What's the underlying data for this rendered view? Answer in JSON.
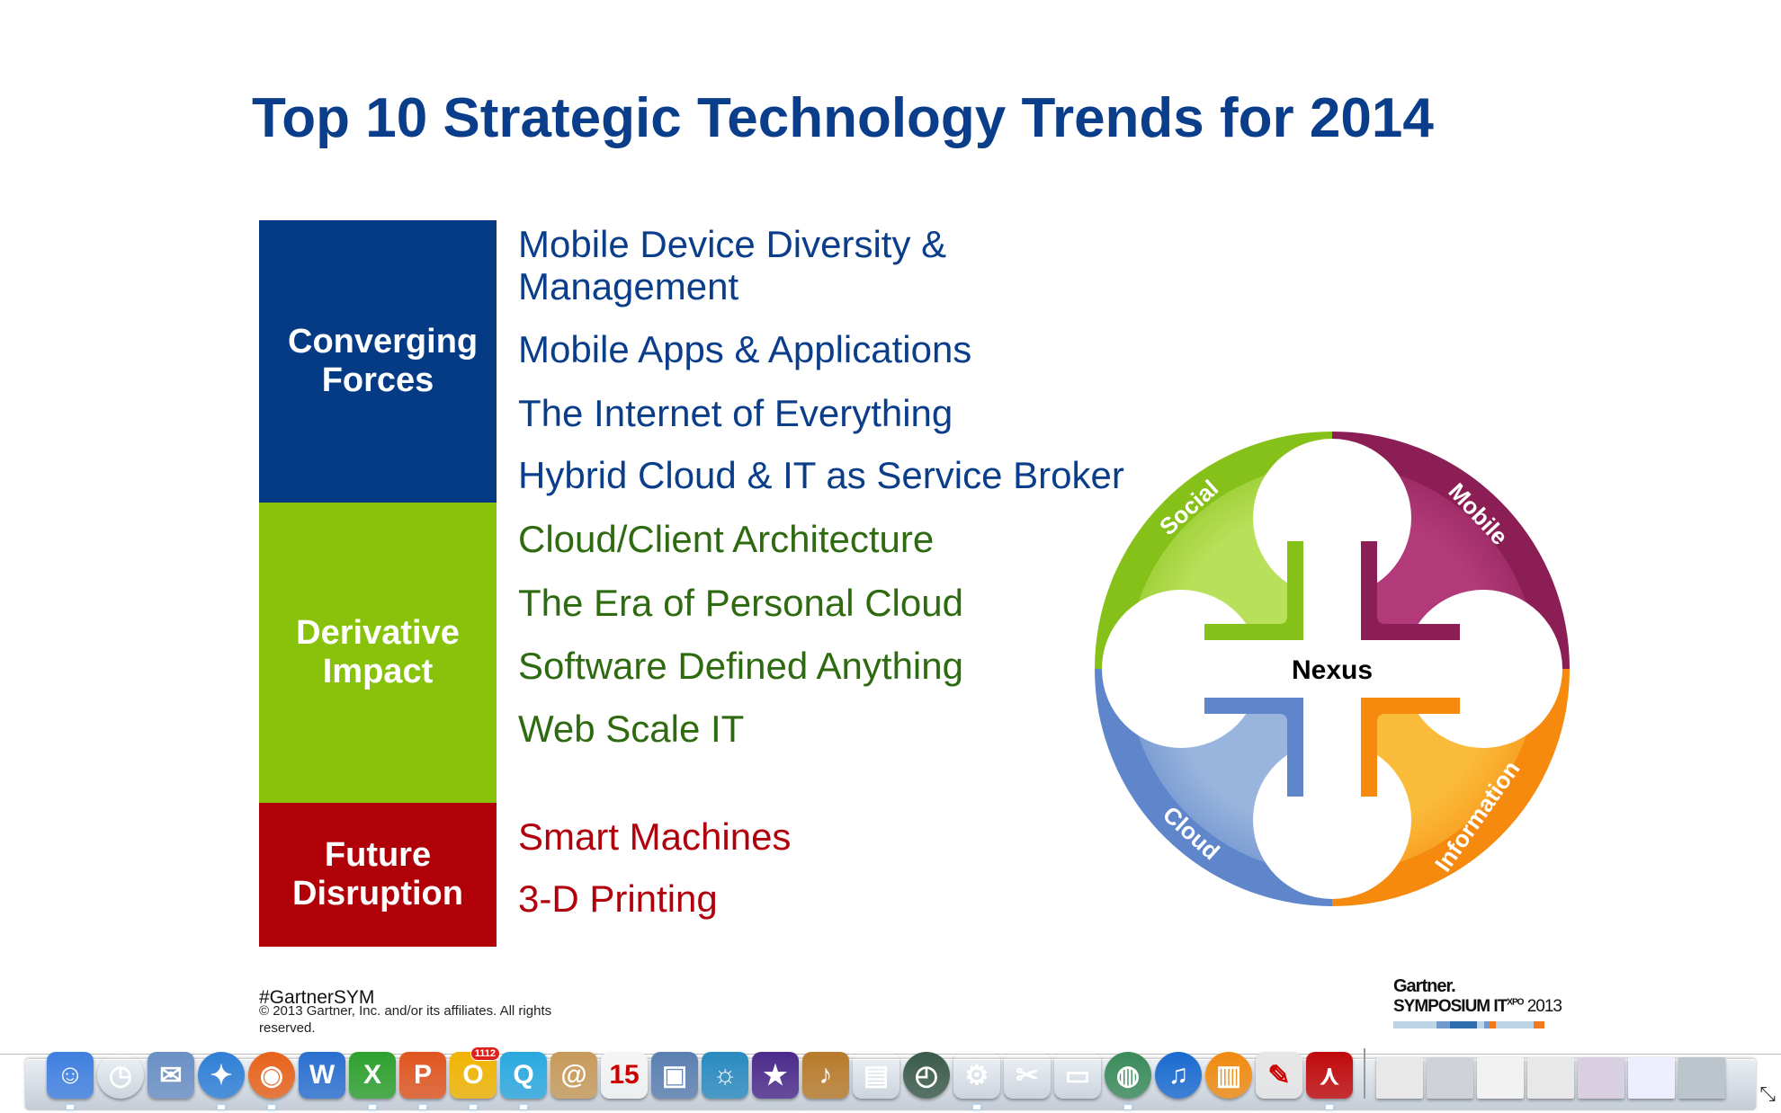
{
  "slide": {
    "title": "Top 10 Strategic Technology Trends for 2014",
    "groups": [
      {
        "label": "Converging Forces",
        "color": "#053a85",
        "items": [
          "Mobile Device Diversity & Management",
          "Mobile Apps & Applications",
          "The Internet of Everything",
          "Hybrid Cloud & IT as Service Broker"
        ]
      },
      {
        "label": "Derivative Impact",
        "color": "#88c20a",
        "items": [
          "Cloud/Client Architecture",
          "The Era of Personal Cloud",
          "Software Defined Anything",
          "Web Scale IT"
        ]
      },
      {
        "label": "Future Disruption",
        "color": "#b00008",
        "items": [
          "Smart Machines",
          "3-D Printing"
        ]
      }
    ],
    "item_line1": "Mobile Device Diversity &",
    "item_line2": "Management",
    "nexus": {
      "center": "Nexus",
      "segments": [
        {
          "label": "Social",
          "color": "#86c11a"
        },
        {
          "label": "Mobile",
          "color": "#8b1f55"
        },
        {
          "label": "Information",
          "color": "#f58a0f"
        },
        {
          "label": "Cloud",
          "color": "#5f86cb"
        }
      ]
    },
    "footer": {
      "hashtag": "#GartnerSYM",
      "copyright": "© 2013 Gartner, Inc. and/or its affiliates. All rights reserved."
    },
    "logo": {
      "brand": "Gartner.",
      "event": "SYMPOSIUM IT",
      "xpo": "XPO",
      "year": "2013"
    }
  },
  "dock": {
    "apps": [
      {
        "name": "finder",
        "color": "#3f7fe0",
        "glyph": "☺",
        "running": true
      },
      {
        "name": "dashboard",
        "color": "#222",
        "glyph": "◷",
        "round": true
      },
      {
        "name": "mail",
        "color": "#6a8fc4",
        "glyph": "✉"
      },
      {
        "name": "safari",
        "color": "#2e7fd6",
        "glyph": "✦",
        "round": true,
        "running": true
      },
      {
        "name": "firefox",
        "color": "#e8621a",
        "glyph": "◉",
        "round": true,
        "running": true
      },
      {
        "name": "word",
        "color": "#2a6fd0",
        "glyph": "W"
      },
      {
        "name": "excel",
        "color": "#2da02d",
        "glyph": "X",
        "running": true
      },
      {
        "name": "powerpoint",
        "color": "#e0551e",
        "glyph": "P",
        "running": true
      },
      {
        "name": "outlook",
        "color": "#f0b400",
        "glyph": "O",
        "badge": "1112",
        "running": true
      },
      {
        "name": "communicator",
        "color": "#2aa8e0",
        "glyph": "Q",
        "running": true
      },
      {
        "name": "address-book",
        "color": "#c89a5a",
        "glyph": "@"
      },
      {
        "name": "calendar",
        "color": "#f4f4f4",
        "glyph": "15",
        "dark": true
      },
      {
        "name": "preview",
        "color": "#5a7fb0",
        "glyph": "▣"
      },
      {
        "name": "iphoto",
        "color": "#2a8ac0",
        "glyph": "☼"
      },
      {
        "name": "imovie",
        "color": "#4b2a8a",
        "glyph": "★"
      },
      {
        "name": "garageband",
        "color": "#b87a2a",
        "glyph": "♪"
      },
      {
        "name": "photo-booth",
        "color": "#444",
        "glyph": "▤"
      },
      {
        "name": "time-machine",
        "color": "#3a5a4a",
        "glyph": "◴",
        "round": true
      },
      {
        "name": "system-preferences",
        "color": "#888",
        "glyph": "⚙",
        "running": true
      },
      {
        "name": "utility",
        "color": "#bbb",
        "glyph": "✂"
      },
      {
        "name": "network-tool",
        "color": "#223",
        "glyph": "▭"
      },
      {
        "name": "vpn-client",
        "color": "#3a8a5a",
        "glyph": "◍",
        "round": true,
        "running": true
      },
      {
        "name": "itunes",
        "color": "#1a6ad0",
        "glyph": "♫",
        "round": true
      },
      {
        "name": "ibooks",
        "color": "#f08a10",
        "glyph": "▥",
        "round": true
      },
      {
        "name": "app-store-doc",
        "color": "#e6e6e6",
        "glyph": "✎",
        "dark": true
      },
      {
        "name": "adobe-reader",
        "color": "#c0080a",
        "glyph": "⋏",
        "running": true
      }
    ],
    "windows": [
      {
        "name": "outlook-window",
        "color": "#e8e8e8"
      },
      {
        "name": "powerpoint-window",
        "color": "#cfd3d8"
      },
      {
        "name": "safari-window",
        "color": "#f2f2f2"
      },
      {
        "name": "outlook-window-2",
        "color": "#e8e8e8"
      },
      {
        "name": "firefox-window",
        "color": "#d8d0e0"
      },
      {
        "name": "firefox-window-2",
        "color": "#eef"
      },
      {
        "name": "trash",
        "color": "#bcc4cc"
      }
    ]
  }
}
